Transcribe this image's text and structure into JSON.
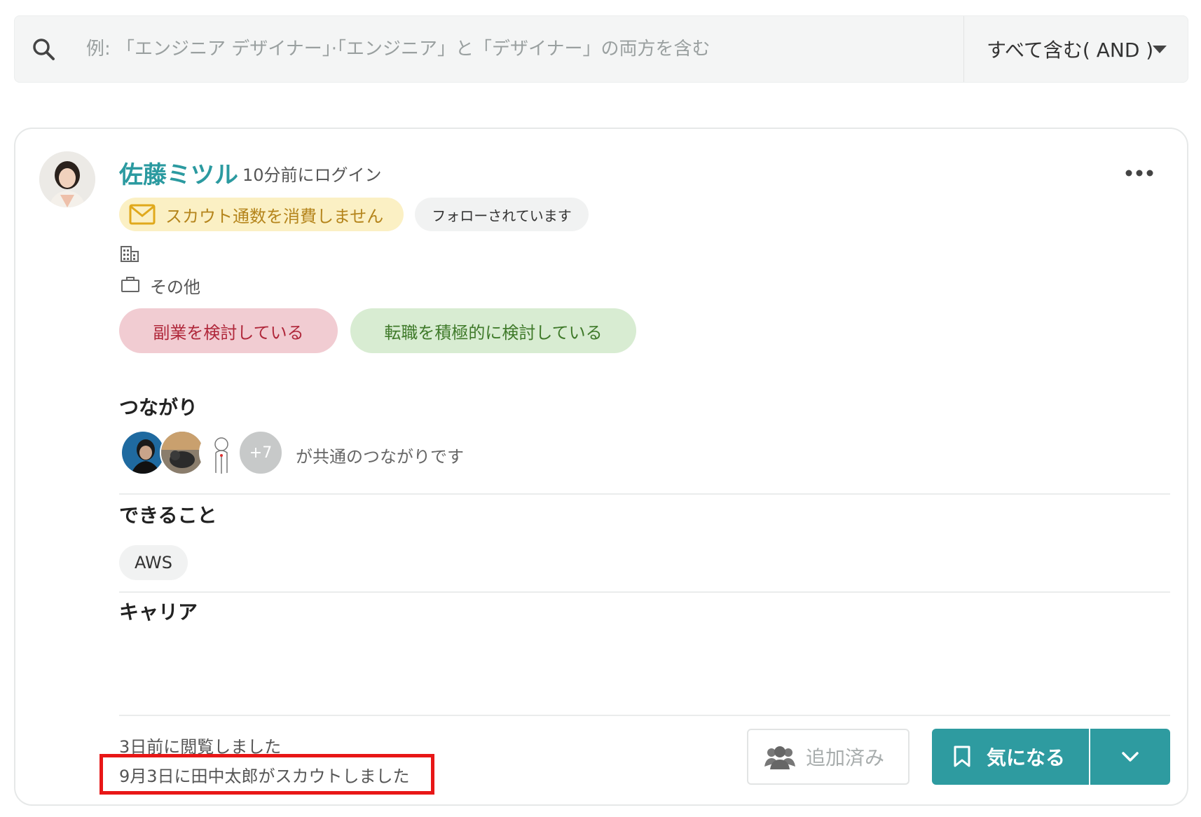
{
  "search": {
    "placeholder": "例: 「エンジニア デザイナー」·「エンジニア」と「デザイナー」の両方を含む",
    "value": "",
    "mode_label": "すべて含む( AND )"
  },
  "profile": {
    "name": "佐藤ミツル",
    "login_status": "10分前にログイン",
    "badge_scout": "スカウト通数を消費しません",
    "badge_follow": "フォローされています",
    "job": "その他",
    "tags": {
      "side_job": "副業を検討している",
      "job_change": "転職を積極的に検討している"
    }
  },
  "connections": {
    "title": "つながり",
    "more_count": "+7",
    "text": "が共通のつながりです"
  },
  "skills": {
    "title": "できること",
    "items": [
      "AWS"
    ]
  },
  "career": {
    "title": "キャリア"
  },
  "footer": {
    "viewed": "3日前に閲覧しました",
    "scouted": "9月3日に田中太郎がスカウトしました",
    "added_label": "追加済み",
    "like_label": "気になる"
  },
  "colors": {
    "accent": "#2e9ba0",
    "highlight_box": "#e81717",
    "scout_badge_bg": "#fbf0c4",
    "side_tag_bg": "#f1ccd2",
    "change_tag_bg": "#d8ecd2"
  },
  "icons": {
    "search": "search-icon",
    "mode_caret": "caret-down-icon",
    "more": "more-horizontal-icon",
    "mail": "mail-icon",
    "company": "building-icon",
    "job": "briefcase-icon",
    "added": "users-icon",
    "like": "bookmark-icon",
    "dropdown": "chevron-down-icon"
  }
}
